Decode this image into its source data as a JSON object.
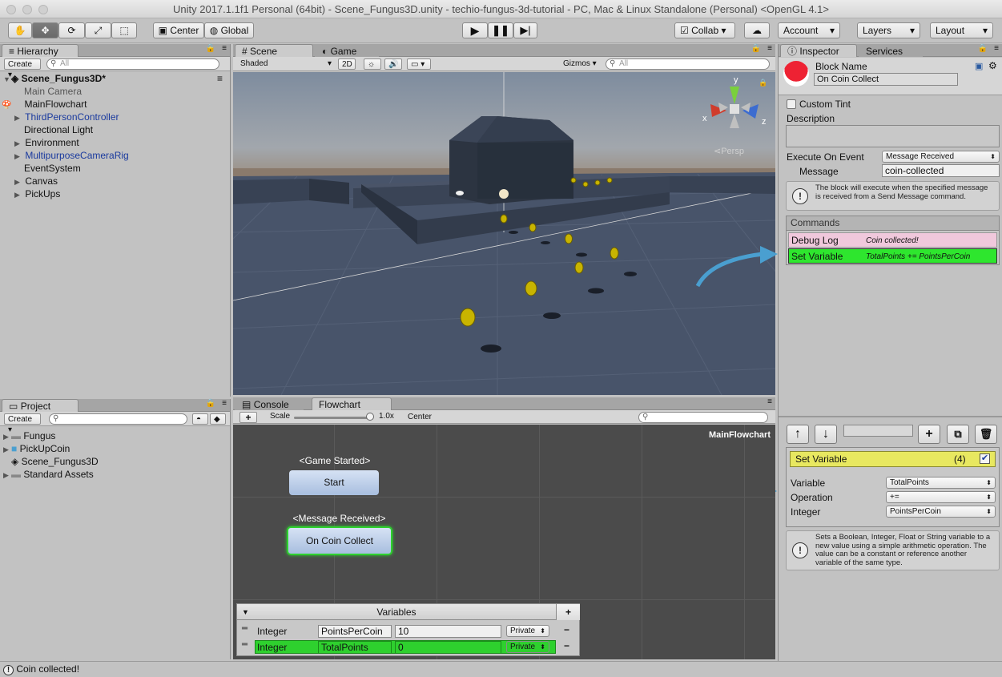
{
  "window": {
    "title": "Unity 2017.1.1f1 Personal (64bit) - Scene_Fungus3D.unity - techio-fungus-3d-tutorial - PC, Mac & Linux Standalone (Personal) <OpenGL 4.1>"
  },
  "toolbar": {
    "center": "Center",
    "global": "Global",
    "collab": "Collab",
    "account": "Account",
    "layers": "Layers",
    "layout": "Layout"
  },
  "hierarchy": {
    "tab": "Hierarchy",
    "create": "Create",
    "search_placeholder": "All",
    "scene": "Scene_Fungus3D*",
    "items": [
      "Main Camera",
      "MainFlowchart",
      "ThirdPersonController",
      "Directional Light",
      "Environment",
      "MultipurposeCameraRig",
      "EventSystem",
      "Canvas",
      "PickUps"
    ]
  },
  "scene_view": {
    "tab_scene": "Scene",
    "tab_game": "Game",
    "shading": "Shaded",
    "mode_2d": "2D",
    "gizmos": "Gizmos",
    "search_placeholder": "All",
    "persp": "Persp",
    "axis_x": "x",
    "axis_y": "y",
    "axis_z": "z"
  },
  "project": {
    "tab": "Project",
    "create": "Create",
    "items": [
      "Fungus",
      "PickUpCoin",
      "Scene_Fungus3D",
      "Standard Assets"
    ]
  },
  "flowchart": {
    "tab_console": "Console",
    "tab_flowchart": "Flowchart",
    "add": "+",
    "scale_label": "Scale",
    "scale_value": "1.0x",
    "center": "Center",
    "name": "MainFlowchart",
    "block1_event": "<Game Started>",
    "block1_label": "Start",
    "block2_event": "<Message Received>",
    "block2_label": "On Coin Collect",
    "variables_title": "Variables",
    "variables": [
      {
        "type": "Integer",
        "key": "PointsPerCoin",
        "value": "10",
        "scope": "Private"
      },
      {
        "type": "Integer",
        "key": "TotalPoints",
        "value": "0",
        "scope": "Private"
      }
    ]
  },
  "inspector": {
    "tab": "Inspector",
    "tab_services": "Services",
    "block_name_label": "Block Name",
    "block_name": "On Coin Collect",
    "custom_tint": "Custom Tint",
    "description_label": "Description",
    "execute_on_event_label": "Execute On Event",
    "execute_on_event": "Message Received",
    "message_label": "Message",
    "message": "coin-collected",
    "event_help": "The block will execute when the specified message is received from a Send Message command.",
    "commands_title": "Commands",
    "commands": [
      {
        "name": "Debug Log",
        "summary": "Coin collected!",
        "color": "#f0c8dc"
      },
      {
        "name": "Set Variable",
        "summary": "TotalPoints += PointsPerCoin",
        "color": "#2ee62e"
      }
    ],
    "cmd_title": "Set Variable",
    "cmd_index": "(4)",
    "variable_label": "Variable",
    "variable": "TotalPoints",
    "operation_label": "Operation",
    "operation": "+=",
    "integer_label": "Integer",
    "integer": "PointsPerCoin",
    "cmd_help": "Sets a Boolean, Integer, Float or String variable to a new value using a simple arithmetic operation. The value can be a constant or reference another variable of the same type."
  },
  "status": {
    "text": "Coin collected!"
  }
}
